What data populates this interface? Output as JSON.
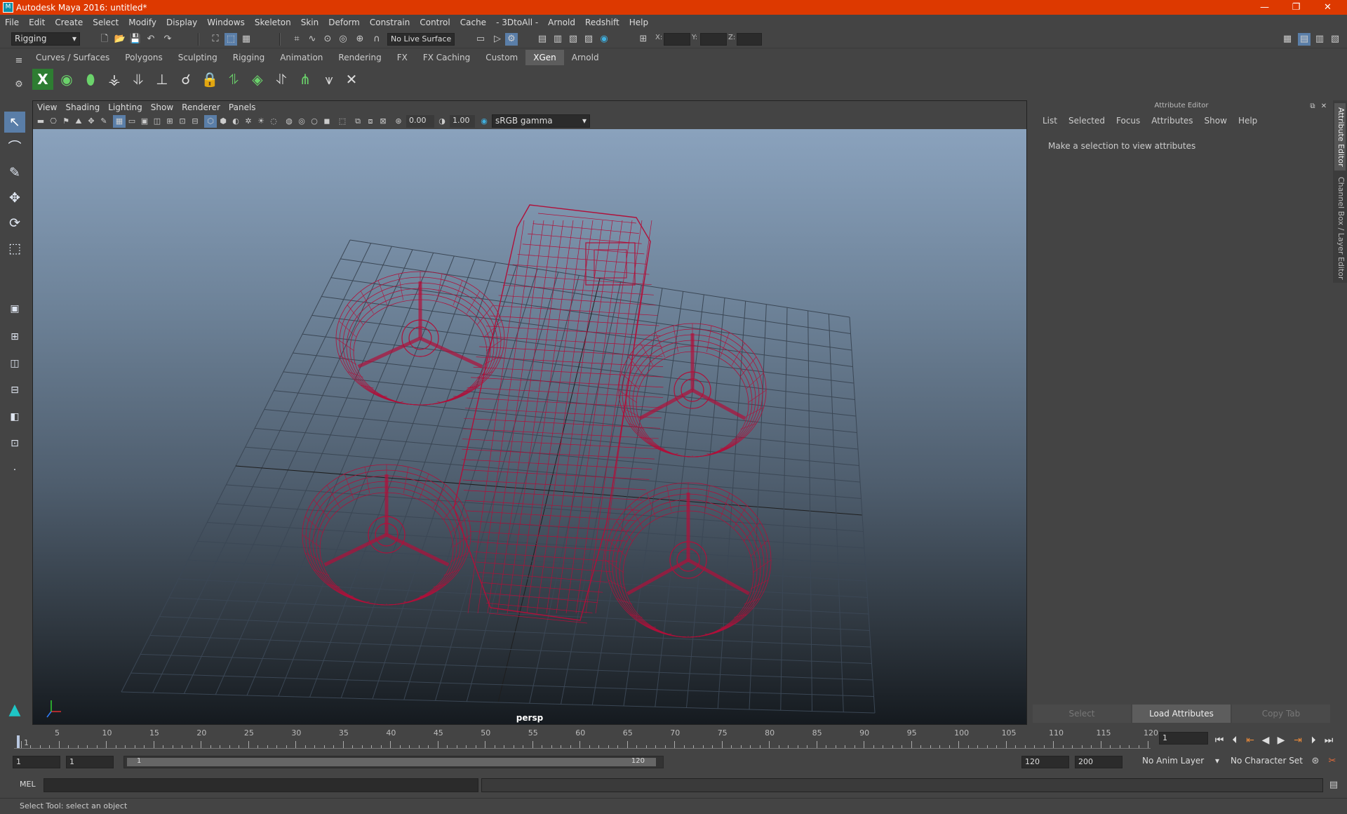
{
  "window": {
    "title": "Autodesk Maya 2016: untitled*",
    "app_icon": "maya-icon",
    "minimize": "—",
    "restore": "❐",
    "close": "✕"
  },
  "menubar": [
    "File",
    "Edit",
    "Create",
    "Select",
    "Modify",
    "Display",
    "Windows",
    "Skeleton",
    "Skin",
    "Deform",
    "Constrain",
    "Control",
    "Cache",
    "- 3DtoAll -",
    "Arnold",
    "Redshift",
    "Help"
  ],
  "statusline": {
    "mode": "Rigging",
    "live_surface": "No Live Surface",
    "x_label": "X:",
    "y_label": "Y:",
    "z_label": "Z:"
  },
  "shelf": {
    "tabs": [
      "Curves / Surfaces",
      "Polygons",
      "Sculpting",
      "Rigging",
      "Animation",
      "Rendering",
      "FX",
      "FX Caching",
      "Custom",
      "XGen",
      "Arnold"
    ],
    "active_tab": "XGen"
  },
  "viewport": {
    "menu": [
      "View",
      "Shading",
      "Lighting",
      "Show",
      "Renderer",
      "Panels"
    ],
    "exposure": "0.00",
    "gamma": "1.00",
    "color_space": "sRGB gamma",
    "camera": "persp",
    "wire_color": "#b0103a"
  },
  "attribute_editor": {
    "title": "Attribute Editor",
    "menu": [
      "List",
      "Selected",
      "Focus",
      "Attributes",
      "Show",
      "Help"
    ],
    "message": "Make a selection to view attributes",
    "buttons": {
      "select": "Select",
      "load": "Load Attributes",
      "copy": "Copy Tab"
    }
  },
  "side_tabs": [
    "Attribute Editor",
    "Channel Box / Layer Editor"
  ],
  "timeline": {
    "labels": [
      "1",
      "5",
      "10",
      "15",
      "20",
      "25",
      "30",
      "35",
      "40",
      "45",
      "50",
      "55",
      "60",
      "65",
      "70",
      "75",
      "80",
      "85",
      "90",
      "95",
      "100",
      "105",
      "110",
      "115",
      "120"
    ],
    "current_frame": "1",
    "start_min": "1",
    "start": "1",
    "range_start": "1",
    "range_end": "120",
    "end": "120",
    "end_max": "200",
    "anim_layer": "No Anim Layer",
    "character_set": "No Character Set"
  },
  "command_line": {
    "label": "MEL"
  },
  "help_line": "Select Tool: select an object"
}
